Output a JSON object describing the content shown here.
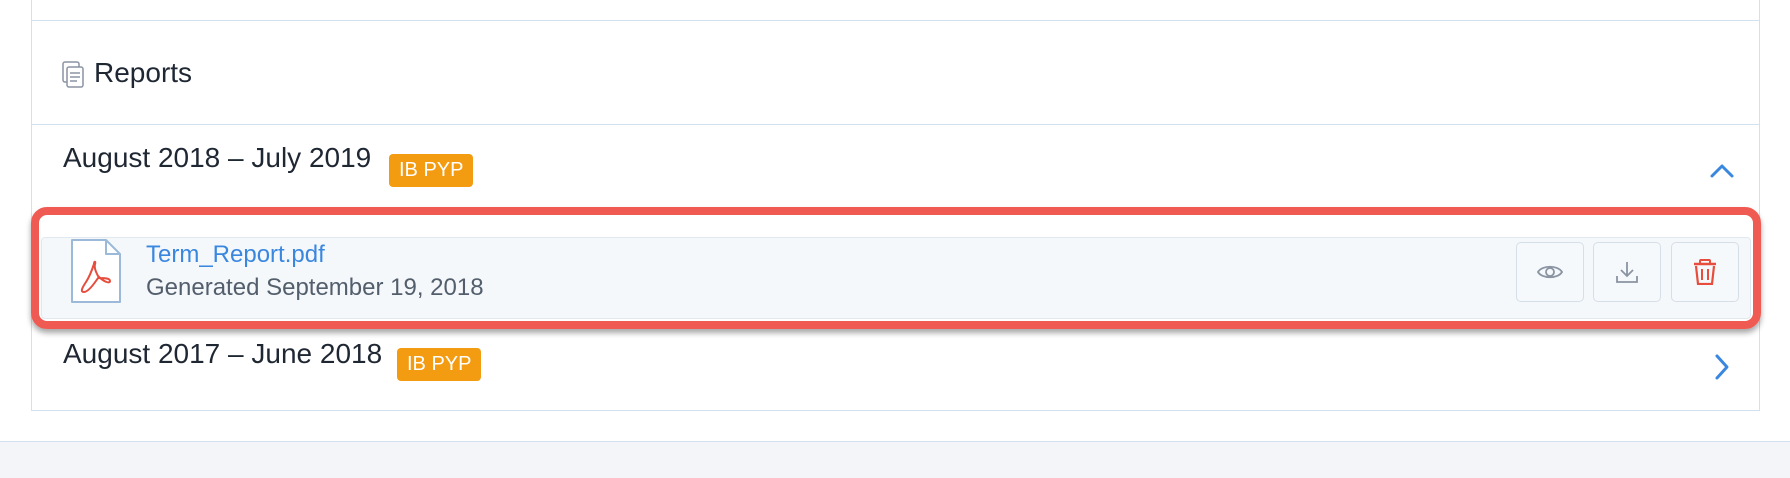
{
  "reports": {
    "title": "Reports",
    "icon": "document-stack-icon"
  },
  "terms": [
    {
      "label": "August 2018 – July 2019",
      "badge": "IB PYP",
      "expanded": true,
      "chevron": "chevron-up-icon"
    },
    {
      "label": "August 2017 – June 2018",
      "badge": "IB PYP",
      "expanded": false,
      "chevron": "chevron-right-icon"
    }
  ],
  "file": {
    "name": "Term_Report.pdf",
    "meta": "Generated September 19, 2018",
    "icon": "pdf-file-icon",
    "actions": [
      "eye-icon",
      "download-icon",
      "trash-icon"
    ]
  },
  "colors": {
    "badge": "#f39c12",
    "link": "#3a87e0",
    "delete": "#e74c3c",
    "highlight": "#ef5b52",
    "border": "#d3e0ee"
  }
}
